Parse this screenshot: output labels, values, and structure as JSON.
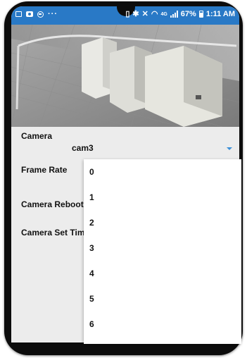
{
  "status_bar": {
    "more_indicator": "···",
    "network_type": "4G",
    "battery_percent": "67%",
    "time": "1:11 AM"
  },
  "form": {
    "camera_label": "Camera",
    "camera_selected": "cam3",
    "frame_rate_label": "Frame Rate",
    "camera_reboot_label": "Camera Reboot",
    "camera_set_time_label": "Camera Set Time"
  },
  "frame_rate_dropdown": {
    "options": [
      "0",
      "1",
      "2",
      "3",
      "4",
      "5",
      "6"
    ]
  },
  "colors": {
    "status_bar": "#2979c6",
    "dropdown_arrow": "#3a8fd8",
    "form_background": "#ececec"
  }
}
